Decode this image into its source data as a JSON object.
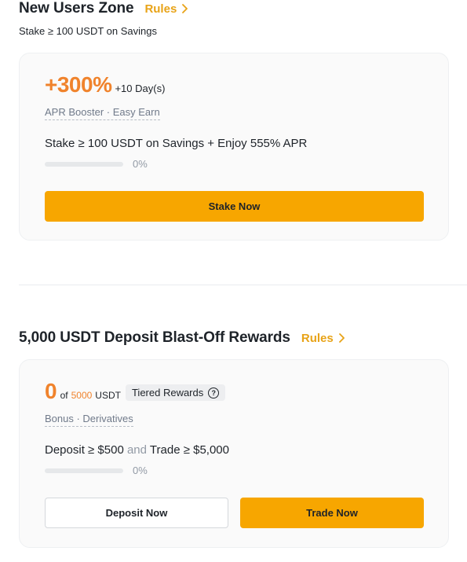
{
  "new_users": {
    "title": "New Users Zone",
    "rules_label": "Rules",
    "subtitle": "Stake ≥ 100 USDT on Savings",
    "card": {
      "boost": "+300%",
      "boost_suffix": "+10 Day(s)",
      "tag": "APR Booster · Easy Earn",
      "task": "Stake ≥ 100 USDT on Savings + Enjoy 555% APR",
      "progress_value": 0,
      "progress_label": "0%",
      "button": "Stake Now"
    }
  },
  "deposit_rewards": {
    "title": "5,000 USDT Deposit Blast-Off Rewards",
    "rules_label": "Rules",
    "card": {
      "current": "0",
      "of_label": "of",
      "target": "5000",
      "unit": "USDT",
      "badge": "Tiered Rewards",
      "tag": "Bonus · Derivatives",
      "task_part1": "Deposit ≥ $500",
      "task_and": "and",
      "task_part2": "Trade ≥ $5,000",
      "progress_value": 0,
      "progress_label": "0%",
      "deposit_button": "Deposit Now",
      "trade_button": "Trade Now"
    }
  },
  "colors": {
    "accent": "#f7a600",
    "highlight": "#f0832c",
    "rules": "#e8a317"
  }
}
